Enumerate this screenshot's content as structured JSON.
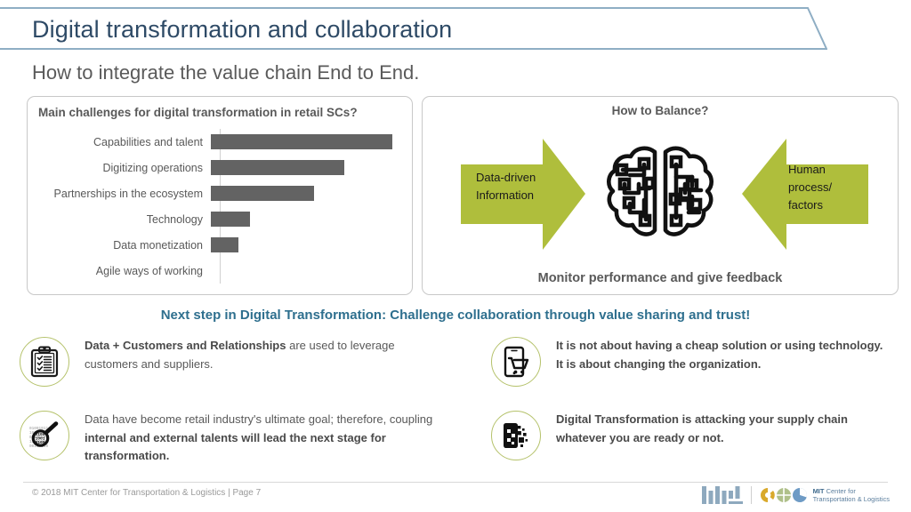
{
  "header": {
    "title": "Digital transformation and collaboration",
    "subtitle": "How to integrate the value chain End to End.",
    "banner_border_color": "#8FAEC4",
    "title_color": "#2E4A66"
  },
  "chart_panel": {
    "heading": "Main challenges for digital transformation in retail SCs?"
  },
  "chart_data": {
    "type": "bar",
    "orientation": "horizontal",
    "title": "Main challenges for digital transformation in retail SCs?",
    "categories": [
      "Capabilities and talent",
      "Digitizing operations",
      "Partnerships in the ecosystem",
      "Technology",
      "Data monetization",
      "Agile ways of working"
    ],
    "values": [
      194,
      142,
      110,
      42,
      29,
      0
    ],
    "xlabel": "",
    "ylabel": "",
    "xlim": [
      0,
      205
    ],
    "grid": false,
    "legend": false,
    "bar_color": "#636363",
    "axis_color": "#D0D0D0"
  },
  "balance_panel": {
    "title": "How to Balance?",
    "left_arrow_line1": "Data-driven",
    "left_arrow_line2": "Information",
    "right_arrow_line1": "Human",
    "right_arrow_line2": "process/",
    "right_arrow_line3": "factors",
    "footer_text": "Monitor performance and give feedback",
    "arrow_color": "#AFBE3C",
    "brain_icon": "brain-circuit-icon"
  },
  "next_step": {
    "text": "Next step in Digital Transformation: Challenge collaboration through value sharing and trust!",
    "color": "#2E6F8E"
  },
  "bullets": [
    {
      "icon": "clipboard-checklist-icon",
      "bold_lead": "Data + Customers and Relationships",
      "rest": " are used to leverage customers and suppliers."
    },
    {
      "icon": "magnifier-binary-icon",
      "plain_lead": "Data have become retail industry's ultimate goal; therefore, coupling ",
      "bold_mid": "internal and external talents will  lead the next stage for transformation."
    },
    {
      "icon": "phone-cart-icon",
      "bold_all": "It is not about having a cheap solution or using technology. It is about changing the organization."
    },
    {
      "icon": "phone-pixels-icon",
      "bold_all": "Digital Transformation is attacking your supply chain whatever you are ready or not."
    }
  ],
  "footer": {
    "copyright": "© 2018 MIT Center for Transportation & Logistics  |  Page 7",
    "mit_logo": "mit-logo",
    "ctl_mark": "ctl-circles-logo",
    "ctl_line1_bold": "MIT",
    "ctl_line1_rest": " Center for",
    "ctl_line2": "Transportation & Logistics",
    "ctl_colors": [
      "#D9A92B",
      "#AFC08A",
      "#6E9BC5"
    ]
  }
}
